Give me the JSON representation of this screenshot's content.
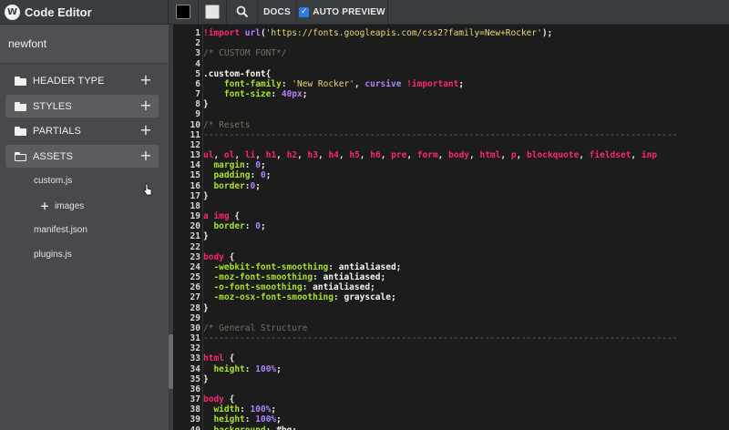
{
  "app": {
    "title": "Code Editor",
    "logo_letter": "W"
  },
  "toolbar": {
    "docs_label": "DOCS",
    "auto_preview_label": "AUTO PREVIEW",
    "auto_preview_checked": true
  },
  "colors": {
    "dark_swatch": "#000000",
    "light_swatch": "#e0e0e0",
    "accent": "#2d7be5"
  },
  "sidebar": {
    "project": "newfont",
    "folders": [
      {
        "label": "HEADER TYPE",
        "icon": "folder-icon"
      },
      {
        "label": "STYLES",
        "icon": "folder-icon"
      },
      {
        "label": "PARTIALS",
        "icon": "folder-icon"
      },
      {
        "label": "ASSETS",
        "icon": "folder-open-icon"
      }
    ],
    "files": [
      "custom.js",
      "images",
      "manifest.json",
      "plugins.js"
    ]
  },
  "editor": {
    "lines": [
      {
        "n": "1",
        "code": "!import url('https://fonts.googleapis.com/css2?family=New+Rocker');"
      },
      {
        "n": "2",
        "code": ""
      },
      {
        "n": "3",
        "code": "/* CUSTOM FONT*/"
      },
      {
        "n": "4",
        "code": ""
      },
      {
        "n": "5",
        "code": ".custom-font{"
      },
      {
        "n": "6",
        "code": "    font-family: 'New Rocker', cursive !important;"
      },
      {
        "n": "7",
        "code": "    font-size: 40px;"
      },
      {
        "n": "8",
        "code": "}"
      },
      {
        "n": "9",
        "code": ""
      },
      {
        "n": "10",
        "code": "/* Resets"
      },
      {
        "n": "11",
        "code": "-------------------------------------------------------------------------------------------"
      },
      {
        "n": "12",
        "code": ""
      },
      {
        "n": "13",
        "code": "ul, ol, li, h1, h2, h3, h4, h5, h6, pre, form, body, html, p, blockquote, fieldset, inp"
      },
      {
        "n": "14",
        "code": "  margin: 0;"
      },
      {
        "n": "15",
        "code": "  padding: 0;"
      },
      {
        "n": "16",
        "code": "  border:0;"
      },
      {
        "n": "17",
        "code": "}"
      },
      {
        "n": "18",
        "code": ""
      },
      {
        "n": "19",
        "code": "a img {"
      },
      {
        "n": "20",
        "code": "  border: 0;"
      },
      {
        "n": "21",
        "code": "}"
      },
      {
        "n": "22",
        "code": ""
      },
      {
        "n": "23",
        "code": "body {"
      },
      {
        "n": "24",
        "code": "  -webkit-font-smoothing: antialiased;"
      },
      {
        "n": "25",
        "code": "  -moz-font-smoothing: antialiased;"
      },
      {
        "n": "26",
        "code": "  -o-font-smoothing: antialiased;"
      },
      {
        "n": "27",
        "code": "  -moz-osx-font-smoothing: grayscale;"
      },
      {
        "n": "28",
        "code": "}"
      },
      {
        "n": "29",
        "code": ""
      },
      {
        "n": "30",
        "code": "/* General Structure"
      },
      {
        "n": "31",
        "code": "-------------------------------------------------------------------------------------------"
      },
      {
        "n": "32",
        "code": ""
      },
      {
        "n": "33",
        "code": "html {"
      },
      {
        "n": "34",
        "code": "  height: 100%;"
      },
      {
        "n": "35",
        "code": "}"
      },
      {
        "n": "36",
        "code": ""
      },
      {
        "n": "37",
        "code": "body {"
      },
      {
        "n": "38",
        "code": "  width: 100%;"
      },
      {
        "n": "39",
        "code": "  height: 100%;"
      },
      {
        "n": "40",
        "code": "  background: #bg;"
      }
    ]
  }
}
